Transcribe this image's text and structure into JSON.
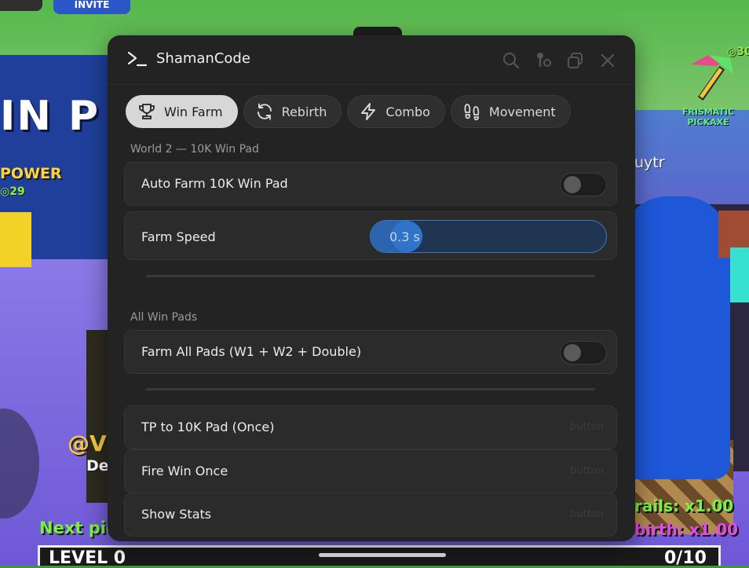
{
  "window": {
    "title": "ShamanCode"
  },
  "tabs": [
    {
      "label": "Win Farm",
      "icon": "trophy-icon",
      "active": true
    },
    {
      "label": "Rebirth",
      "icon": "refresh-icon",
      "active": false
    },
    {
      "label": "Combo",
      "icon": "lightning-icon",
      "active": false
    },
    {
      "label": "Movement",
      "icon": "footprints-icon",
      "active": false
    }
  ],
  "sections": {
    "world2": {
      "label": "World 2 — 10K Win Pad",
      "auto_farm": {
        "label": "Auto Farm 10K Win Pad",
        "enabled": false
      },
      "farm_speed": {
        "label": "Farm Speed",
        "value_text": "0.3 s",
        "fraction": 0.1
      }
    },
    "all_pads": {
      "label": "All Win Pads",
      "farm_all": {
        "label": "Farm All Pads (W1 + W2 + Double)",
        "enabled": false
      }
    },
    "actions": [
      {
        "label": "TP to 10K Pad (Once)",
        "hint": "button"
      },
      {
        "label": "Fire Win Once",
        "hint": "button"
      },
      {
        "label": "Show Stats",
        "hint": "button"
      }
    ]
  },
  "background": {
    "invite_label": "INVITE",
    "banner_text": "IN P",
    "power_label": "POWER",
    "power_value": "29",
    "player_tag": "@V",
    "player_sub": "De",
    "next_pickaxe_label": "Next pic",
    "other_player": "uytr",
    "trails_mult": "rails: x1.00",
    "rebirth_mult": "birth: x1.00",
    "pickaxe_name": "FRISMATIC PICKAXE",
    "pickaxe_cost": "30",
    "level_label": "LEVEL 0",
    "level_progress": "0/10"
  },
  "colors": {
    "panel_bg": "#232323",
    "row_bg": "#2b2b2b",
    "active_tab_bg": "#d7d7d7",
    "slider_accent": "#2f74c9"
  }
}
